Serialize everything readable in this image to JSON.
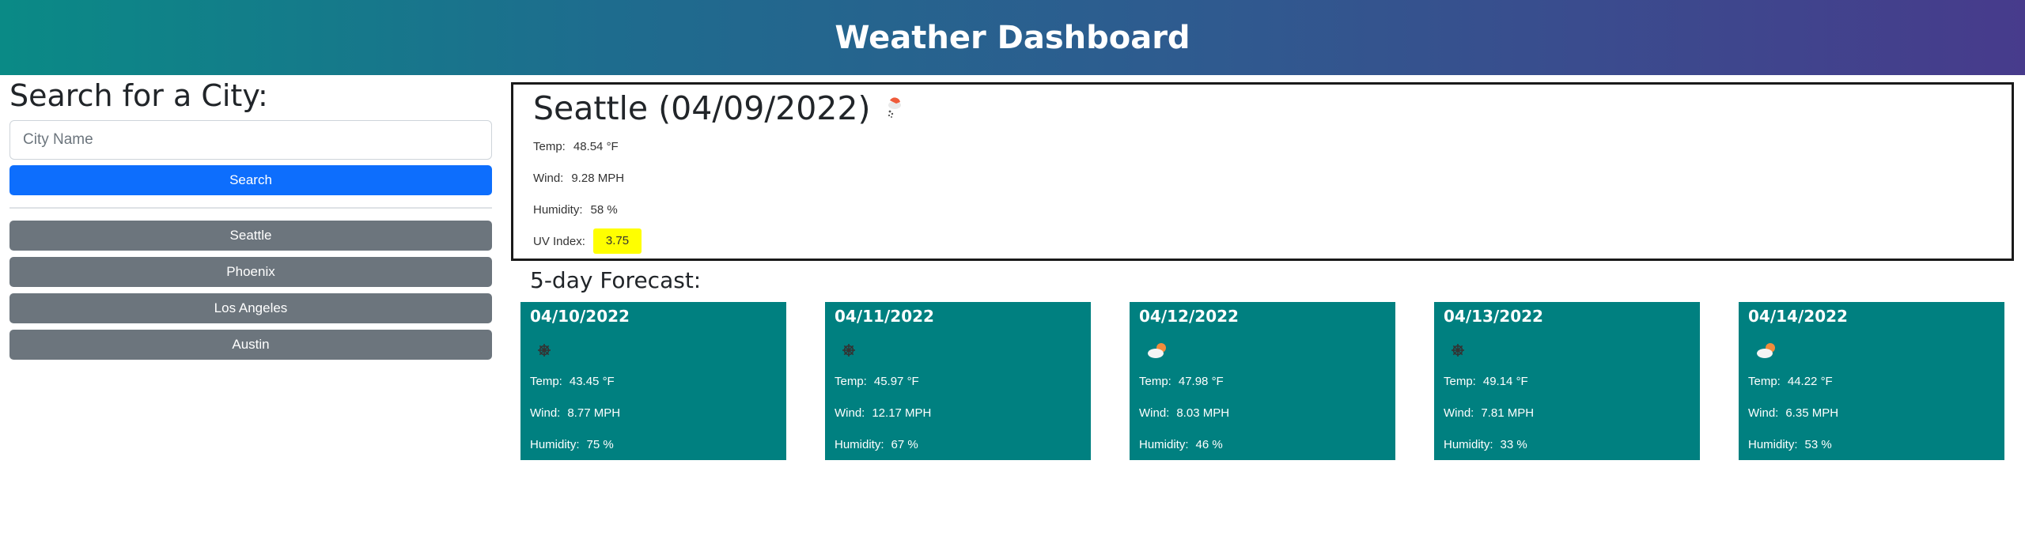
{
  "header": {
    "title": "Weather Dashboard"
  },
  "sidebar": {
    "title": "Search for a City:",
    "input_placeholder": "City Name",
    "input_value": "",
    "search_label": "Search",
    "history": [
      "Seattle",
      "Phoenix",
      "Los Angeles",
      "Austin"
    ]
  },
  "current": {
    "title": "Seattle (04/09/2022)",
    "icon": "light-rain-icon",
    "temp_label": "Temp:",
    "temp": "48.54 °F",
    "wind_label": "Wind:",
    "wind": "9.28 MPH",
    "humidity_label": "Humidity:",
    "humidity": "58 %",
    "uv_label": "UV Index:",
    "uv": "3.75",
    "uv_color": "#ffff00"
  },
  "forecast": {
    "title": "5-day Forecast:",
    "card_color": "#008080",
    "days": [
      {
        "date": "04/10/2022",
        "icon": "snow-icon",
        "temp_label": "Temp:",
        "temp": "43.45 °F",
        "wind_label": "Wind:",
        "wind": "8.77 MPH",
        "humidity_label": "Humidity:",
        "humidity": "75 %"
      },
      {
        "date": "04/11/2022",
        "icon": "snow-icon",
        "temp_label": "Temp:",
        "temp": "45.97 °F",
        "wind_label": "Wind:",
        "wind": "12.17 MPH",
        "humidity_label": "Humidity:",
        "humidity": "67 %"
      },
      {
        "date": "04/12/2022",
        "icon": "partly-cloudy-icon",
        "temp_label": "Temp:",
        "temp": "47.98 °F",
        "wind_label": "Wind:",
        "wind": "8.03 MPH",
        "humidity_label": "Humidity:",
        "humidity": "46 %"
      },
      {
        "date": "04/13/2022",
        "icon": "snow-icon",
        "temp_label": "Temp:",
        "temp": "49.14 °F",
        "wind_label": "Wind:",
        "wind": "7.81 MPH",
        "humidity_label": "Humidity:",
        "humidity": "33 %"
      },
      {
        "date": "04/14/2022",
        "icon": "partly-cloudy-icon",
        "temp_label": "Temp:",
        "temp": "44.22 °F",
        "wind_label": "Wind:",
        "wind": "6.35 MPH",
        "humidity_label": "Humidity:",
        "humidity": "53 %"
      }
    ]
  }
}
